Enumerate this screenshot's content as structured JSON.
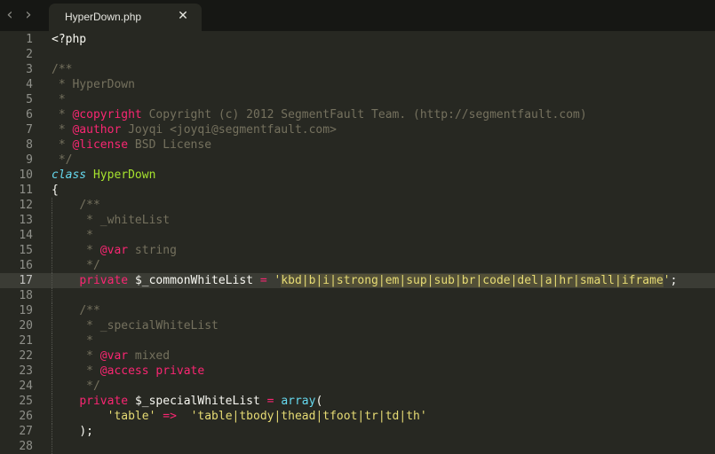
{
  "toolbar": {
    "back_icon": "chevron-left-icon",
    "forward_icon": "chevron-right-icon",
    "back_glyph": "‹",
    "forward_glyph": "›"
  },
  "tab": {
    "title": "HyperDown.php",
    "close_glyph": "✕",
    "close_icon": "close-icon"
  },
  "editor": {
    "current_line": 17,
    "lines": [
      {
        "num": "1",
        "guide": false,
        "current": false,
        "tokens": [
          {
            "t": "<?php",
            "c": "plain"
          }
        ]
      },
      {
        "num": "2",
        "guide": false,
        "current": false,
        "tokens": []
      },
      {
        "num": "3",
        "guide": false,
        "current": false,
        "tokens": [
          {
            "t": "/**",
            "c": "comment"
          }
        ]
      },
      {
        "num": "4",
        "guide": false,
        "current": false,
        "tokens": [
          {
            "t": " * HyperDown",
            "c": "comment"
          }
        ]
      },
      {
        "num": "5",
        "guide": false,
        "current": false,
        "tokens": [
          {
            "t": " *",
            "c": "comment"
          }
        ]
      },
      {
        "num": "6",
        "guide": false,
        "current": false,
        "tokens": [
          {
            "t": " * ",
            "c": "comment"
          },
          {
            "t": "@copyright",
            "c": "tag"
          },
          {
            "t": " Copyright (c) 2012 SegmentFault Team. (http://segmentfault.com)",
            "c": "comment"
          }
        ]
      },
      {
        "num": "7",
        "guide": false,
        "current": false,
        "tokens": [
          {
            "t": " * ",
            "c": "comment"
          },
          {
            "t": "@author",
            "c": "tag"
          },
          {
            "t": " Joyqi <joyqi@segmentfault.com>",
            "c": "comment"
          }
        ]
      },
      {
        "num": "8",
        "guide": false,
        "current": false,
        "tokens": [
          {
            "t": " * ",
            "c": "comment"
          },
          {
            "t": "@license",
            "c": "tag"
          },
          {
            "t": " BSD License",
            "c": "comment"
          }
        ]
      },
      {
        "num": "9",
        "guide": false,
        "current": false,
        "tokens": [
          {
            "t": " */",
            "c": "comment"
          }
        ]
      },
      {
        "num": "10",
        "guide": false,
        "current": false,
        "tokens": [
          {
            "t": "class",
            "c": "storage"
          },
          {
            "t": " ",
            "c": "plain"
          },
          {
            "t": "HyperDown",
            "c": "class"
          }
        ]
      },
      {
        "num": "11",
        "guide": false,
        "current": false,
        "tokens": [
          {
            "t": "{",
            "c": "plain"
          }
        ]
      },
      {
        "num": "12",
        "guide": true,
        "current": false,
        "tokens": [
          {
            "t": "    ",
            "c": "plain"
          },
          {
            "t": "/**",
            "c": "comment"
          }
        ]
      },
      {
        "num": "13",
        "guide": true,
        "current": false,
        "tokens": [
          {
            "t": "    ",
            "c": "plain"
          },
          {
            "t": " * _whiteList",
            "c": "comment"
          }
        ]
      },
      {
        "num": "14",
        "guide": true,
        "current": false,
        "tokens": [
          {
            "t": "    ",
            "c": "plain"
          },
          {
            "t": " *",
            "c": "comment"
          }
        ]
      },
      {
        "num": "15",
        "guide": true,
        "current": false,
        "tokens": [
          {
            "t": "    ",
            "c": "plain"
          },
          {
            "t": " * ",
            "c": "comment"
          },
          {
            "t": "@var",
            "c": "tag"
          },
          {
            "t": " string",
            "c": "comment"
          }
        ]
      },
      {
        "num": "16",
        "guide": true,
        "current": false,
        "tokens": [
          {
            "t": "    ",
            "c": "plain"
          },
          {
            "t": " */",
            "c": "comment"
          }
        ]
      },
      {
        "num": "17",
        "guide": true,
        "current": true,
        "tokens": [
          {
            "t": "    ",
            "c": "plain"
          },
          {
            "t": "private",
            "c": "keyword"
          },
          {
            "t": " ",
            "c": "plain"
          },
          {
            "t": "$_commonWhiteList",
            "c": "var"
          },
          {
            "t": " ",
            "c": "plain"
          },
          {
            "t": "=",
            "c": "keyword"
          },
          {
            "t": " '",
            "c": "string"
          },
          {
            "t": "kbd|b|i|strong|em|sup|sub|br|code|del|a|hr|small|iframe",
            "c": "string",
            "sel": true
          },
          {
            "t": "'",
            "c": "string"
          },
          {
            "t": ";",
            "c": "plain"
          }
        ]
      },
      {
        "num": "18",
        "guide": true,
        "current": false,
        "tokens": []
      },
      {
        "num": "19",
        "guide": true,
        "current": false,
        "tokens": [
          {
            "t": "    ",
            "c": "plain"
          },
          {
            "t": "/**",
            "c": "comment"
          }
        ]
      },
      {
        "num": "20",
        "guide": true,
        "current": false,
        "tokens": [
          {
            "t": "    ",
            "c": "plain"
          },
          {
            "t": " * _specialWhiteList",
            "c": "comment"
          }
        ]
      },
      {
        "num": "21",
        "guide": true,
        "current": false,
        "tokens": [
          {
            "t": "    ",
            "c": "plain"
          },
          {
            "t": " *",
            "c": "comment"
          }
        ]
      },
      {
        "num": "22",
        "guide": true,
        "current": false,
        "tokens": [
          {
            "t": "    ",
            "c": "plain"
          },
          {
            "t": " * ",
            "c": "comment"
          },
          {
            "t": "@var",
            "c": "tag"
          },
          {
            "t": " mixed",
            "c": "comment"
          }
        ]
      },
      {
        "num": "23",
        "guide": true,
        "current": false,
        "tokens": [
          {
            "t": "    ",
            "c": "plain"
          },
          {
            "t": " * ",
            "c": "comment"
          },
          {
            "t": "@access",
            "c": "tag"
          },
          {
            "t": " private",
            "c": "tag"
          }
        ]
      },
      {
        "num": "24",
        "guide": true,
        "current": false,
        "tokens": [
          {
            "t": "    ",
            "c": "plain"
          },
          {
            "t": " */",
            "c": "comment"
          }
        ]
      },
      {
        "num": "25",
        "guide": true,
        "current": false,
        "tokens": [
          {
            "t": "    ",
            "c": "plain"
          },
          {
            "t": "private",
            "c": "keyword"
          },
          {
            "t": " ",
            "c": "plain"
          },
          {
            "t": "$_specialWhiteList",
            "c": "var"
          },
          {
            "t": " ",
            "c": "plain"
          },
          {
            "t": "=",
            "c": "keyword"
          },
          {
            "t": " ",
            "c": "plain"
          },
          {
            "t": "array",
            "c": "func"
          },
          {
            "t": "(",
            "c": "plain"
          }
        ]
      },
      {
        "num": "26",
        "guide": true,
        "current": false,
        "tokens": [
          {
            "t": "        ",
            "c": "plain"
          },
          {
            "t": "'table'",
            "c": "string"
          },
          {
            "t": " ",
            "c": "plain"
          },
          {
            "t": "=>",
            "c": "keyword"
          },
          {
            "t": "  ",
            "c": "plain"
          },
          {
            "t": "'table|tbody|thead|tfoot|tr|td|th'",
            "c": "string"
          }
        ]
      },
      {
        "num": "27",
        "guide": true,
        "current": false,
        "tokens": [
          {
            "t": "    ",
            "c": "plain"
          },
          {
            "t": ");",
            "c": "plain"
          }
        ]
      },
      {
        "num": "28",
        "guide": true,
        "current": false,
        "tokens": []
      }
    ]
  },
  "colors": {
    "background": "#272822",
    "tabbar": "#161714",
    "current_line": "#3b3c35",
    "selection": "#524f37",
    "comment": "#75715e",
    "keyword": "#f92672",
    "string": "#e6db74",
    "class": "#a6e22e",
    "storage": "#66d9ef"
  }
}
